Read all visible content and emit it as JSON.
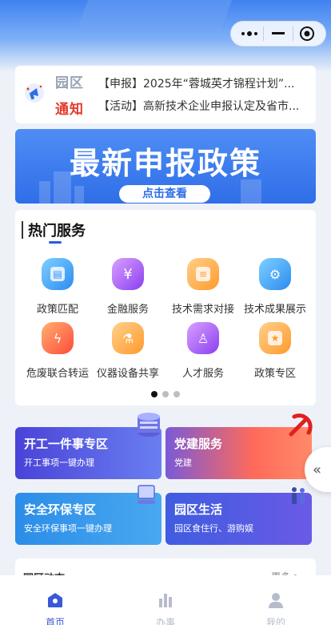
{
  "notice": {
    "tag_line1": "园区",
    "tag_line2": "通知",
    "items": [
      "【申报】2025年“蓉城英才锦程计划”...",
      "【活动】高新技术企业申报认定及省市..."
    ]
  },
  "banner": {
    "title": "最新申报政策",
    "button_label": "点击查看"
  },
  "services": {
    "title": "热门服务",
    "items": [
      {
        "label": "政策匹配",
        "icon": "policy-match-icon"
      },
      {
        "label": "金融服务",
        "icon": "yuan-icon"
      },
      {
        "label": "技术需求对接",
        "icon": "document-icon"
      },
      {
        "label": "技术成果展示",
        "icon": "gear-icon"
      },
      {
        "label": "危废联合转运",
        "icon": "flame-icon"
      },
      {
        "label": "仪器设备共享",
        "icon": "flask-icon"
      },
      {
        "label": "人才服务",
        "icon": "person-icon"
      },
      {
        "label": "政策专区",
        "icon": "policy-zone-icon"
      }
    ],
    "page_count": 3,
    "current_page": 1
  },
  "cards": [
    {
      "title": "开工一件事专区",
      "subtitle": "开工事项一键办理"
    },
    {
      "title": "党建服务",
      "subtitle": "党建"
    },
    {
      "title": "安全环保专区",
      "subtitle": "安全环保事项一键办理"
    },
    {
      "title": "园区生活",
      "subtitle": "园区食住行、游购娱"
    }
  ],
  "news": {
    "title": "园区动态",
    "more": "更多 >"
  },
  "tabbar": {
    "items": [
      {
        "label": "首页",
        "icon": "home-icon"
      },
      {
        "label": "办事",
        "icon": "bar-chart-icon"
      },
      {
        "label": "我的",
        "icon": "user-icon"
      }
    ]
  },
  "colors": {
    "primary": "#3a59d6",
    "header": "#3f82f0",
    "alert_red": "#e5392b"
  }
}
